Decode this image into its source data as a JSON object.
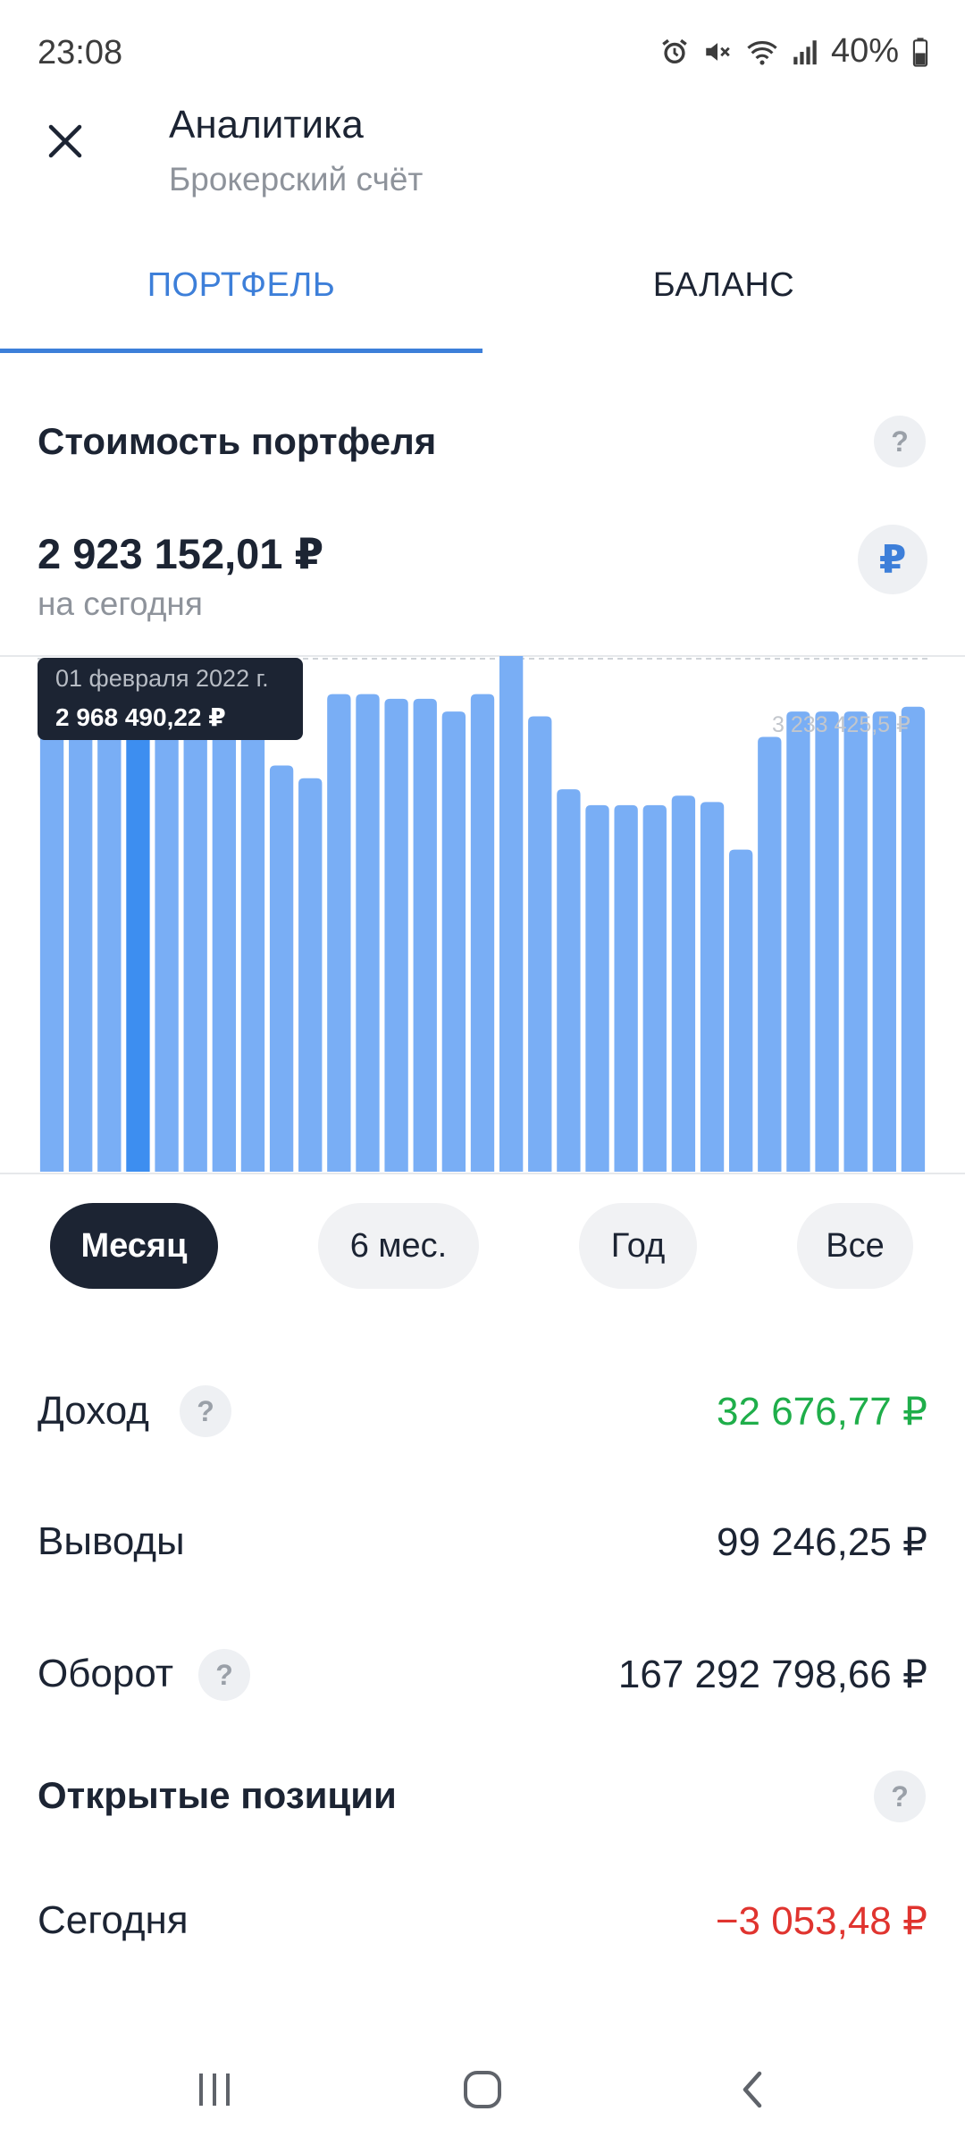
{
  "status_bar": {
    "time": "23:08",
    "battery": "40%"
  },
  "header": {
    "title": "Аналитика",
    "subtitle": "Брокерский счёт"
  },
  "tabs": [
    {
      "label": "ПОРТФЕЛЬ",
      "active": true
    },
    {
      "label": "БАЛАНС",
      "active": false
    }
  ],
  "portfolio": {
    "section_title": "Стоимость портфеля",
    "help_icon": "?",
    "amount": "2 923 152,01 ₽",
    "amount_caption": "на сегодня",
    "currency_button": "₽"
  },
  "chart_data": {
    "type": "bar",
    "reference_line_label": "3 233 425,5 ₽",
    "reference_line_value": 3233425.5,
    "ylim": [
      0,
      3250000
    ],
    "selected_index": 3,
    "tooltip": {
      "date": "01 февраля 2022 г.",
      "value": "2 968 490,22 ₽"
    },
    "values": [
      3010000,
      2990000,
      3220000,
      2968490,
      3080000,
      2960000,
      2950000,
      2950000,
      2560000,
      2480000,
      3010000,
      3010000,
      2980000,
      2980000,
      2900000,
      3010000,
      3290000,
      2870000,
      2410000,
      2310000,
      2310000,
      2310000,
      2370000,
      2330000,
      2030000,
      2740000,
      2900000,
      2900000,
      2900000,
      2900000,
      2930000
    ],
    "colors": {
      "bar": "#79aef5",
      "selected_bar": "#3d8ef0",
      "reference_line": "#cfd3d8"
    }
  },
  "periods": [
    {
      "label": "Месяц",
      "active": true
    },
    {
      "label": "6 мес.",
      "active": false
    },
    {
      "label": "Год",
      "active": false
    },
    {
      "label": "Все",
      "active": false
    }
  ],
  "stats": {
    "income": {
      "label": "Доход",
      "value": "32 676,77 ₽",
      "color": "#1fae4a"
    },
    "withdrawals": {
      "label": "Выводы",
      "value": "99 246,25 ₽"
    },
    "turnover": {
      "label": "Оборот",
      "value": "167 292 798,66 ₽"
    }
  },
  "open_positions": {
    "title": "Открытые позиции",
    "today": {
      "label": "Сегодня",
      "value": "−3 053,48 ₽",
      "color": "#e0342f"
    }
  },
  "nav_bar": {
    "icons": [
      "recent-apps-icon",
      "home-icon",
      "back-icon"
    ]
  }
}
